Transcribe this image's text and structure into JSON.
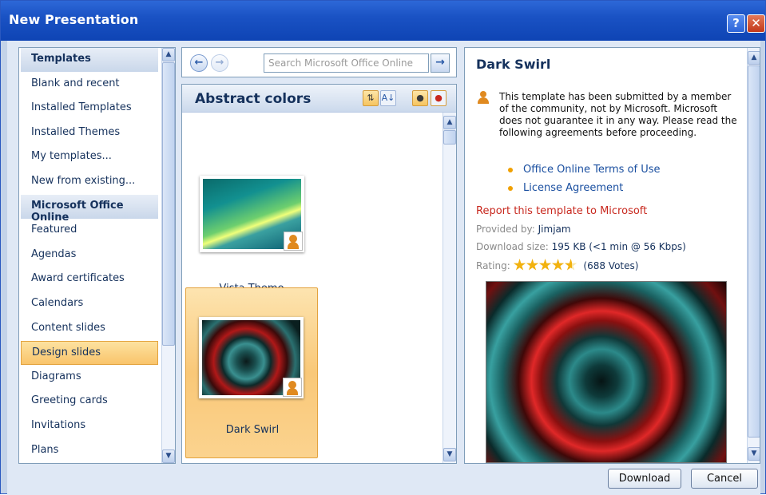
{
  "window": {
    "title": "New Presentation",
    "help_label": "?",
    "close_label": "✕"
  },
  "sidebar": {
    "items": [
      {
        "label": "Templates",
        "type": "header"
      },
      {
        "label": "Blank and recent",
        "type": "item"
      },
      {
        "label": "Installed Templates",
        "type": "item"
      },
      {
        "label": "Installed Themes",
        "type": "item"
      },
      {
        "label": "My templates...",
        "type": "item"
      },
      {
        "label": "New from existing...",
        "type": "item"
      },
      {
        "label": "Microsoft Office Online",
        "type": "header"
      },
      {
        "label": "Featured",
        "type": "item"
      },
      {
        "label": "Agendas",
        "type": "item"
      },
      {
        "label": "Award certificates",
        "type": "item"
      },
      {
        "label": "Calendars",
        "type": "item"
      },
      {
        "label": "Content slides",
        "type": "item"
      },
      {
        "label": "Design slides",
        "type": "selected"
      },
      {
        "label": "Diagrams",
        "type": "item"
      },
      {
        "label": "Greeting cards",
        "type": "item"
      },
      {
        "label": "Invitations",
        "type": "item"
      },
      {
        "label": "Plans",
        "type": "item"
      }
    ]
  },
  "search": {
    "placeholder": "Search Microsoft Office Online"
  },
  "gallery": {
    "title": "Abstract colors",
    "tiles": [
      {
        "caption": "Vista Theme"
      },
      {
        "caption": "Dark Swirl"
      }
    ]
  },
  "details": {
    "title": "Dark Swirl",
    "description": "This template has been submitted by a member of the community, not by Microsoft.  Microsoft does not guarantee it in any way.  Please read the following agreements before proceeding.",
    "links": [
      "Office Online Terms of Use",
      "License Agreement"
    ],
    "report_label": "Report this template to Microsoft",
    "provided_by_label": "Provided by:",
    "provided_by": "Jimjam",
    "download_size_label": "Download size:",
    "download_size": "195 KB (<1 min @ 56 Kbps)",
    "rating_label": "Rating:",
    "rating_value": 4.5,
    "votes": "(688 Votes)"
  },
  "buttons": {
    "download": "Download",
    "cancel": "Cancel"
  },
  "colors": {
    "titlebar": "#1a52c4",
    "selected": "#f9c46b",
    "report": "#c8281e"
  }
}
